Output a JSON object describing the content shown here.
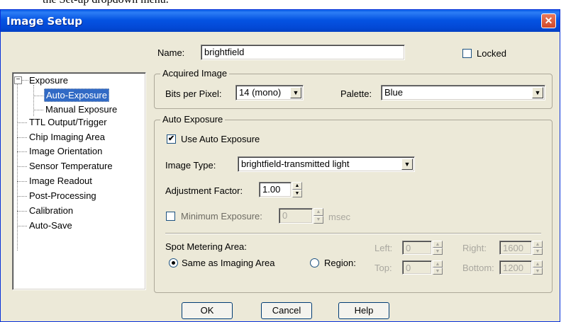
{
  "caption_text": "the Set-up dropdown menu.",
  "window": {
    "title": "Image Setup",
    "close_glyph": "✕"
  },
  "name": {
    "label": "Name:",
    "value": "brightfield"
  },
  "locked": {
    "label": "Locked",
    "checked": false
  },
  "tree": {
    "items": [
      {
        "label": "Exposure",
        "expander": "−"
      },
      {
        "label": "Auto-Exposure",
        "selected": true
      },
      {
        "label": "Manual Exposure"
      },
      {
        "label": "TTL Output/Trigger"
      },
      {
        "label": "Chip Imaging Area"
      },
      {
        "label": "Image Orientation"
      },
      {
        "label": "Sensor Temperature"
      },
      {
        "label": "Image Readout"
      },
      {
        "label": "Post-Processing"
      },
      {
        "label": "Calibration"
      },
      {
        "label": "Auto-Save"
      }
    ]
  },
  "acquired": {
    "legend": "Acquired Image",
    "bits_label": "Bits per Pixel:",
    "bits_value": "14 (mono)",
    "palette_label": "Palette:",
    "palette_value": "Blue"
  },
  "auto_exposure": {
    "legend": "Auto Exposure",
    "use_label": "Use Auto Exposure",
    "use_checked": true,
    "image_type_label": "Image Type:",
    "image_type_value": "brightfield-transmitted light",
    "adjustment_label": "Adjustment Factor:",
    "adjustment_value": "1.00",
    "min_exposure_label": "Minimum Exposure:",
    "min_exposure_value": "0",
    "min_exposure_unit": "msec",
    "spot_label": "Spot Metering Area:",
    "same_label": "Same as Imaging Area",
    "region_label": "Region:",
    "left_label": "Left:",
    "left_value": "0",
    "top_label": "Top:",
    "top_value": "0",
    "right_label": "Right:",
    "right_value": "1600",
    "bottom_label": "Bottom:",
    "bottom_value": "1200"
  },
  "buttons": {
    "ok": "OK",
    "cancel": "Cancel",
    "help": "Help"
  },
  "icons": {
    "dropdown": "▼",
    "spin_up": "▲",
    "spin_down": "▼",
    "check": "✔"
  }
}
